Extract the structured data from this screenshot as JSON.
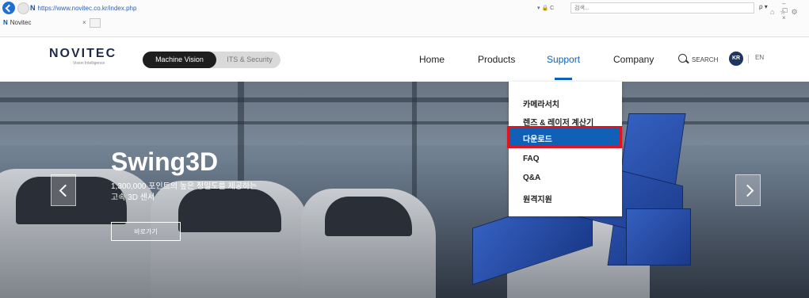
{
  "browser": {
    "url": "https://www.novitec.co.kr/index.php",
    "search_placeholder": "검색...",
    "tab_title": "Novitec",
    "tab_close": "×",
    "favicon": "N",
    "addr_tools": "▾ 🔒 C",
    "search_go": "ρ ▾",
    "right_icons": "⌂ ☆ ⚙",
    "window_controls": "–  ☐  ×"
  },
  "header": {
    "logo": "NOVITEC",
    "logo_tagline": "Vision Intelligence",
    "segment_active": "Machine Vision",
    "segment_inactive": "ITS & Security",
    "nav": [
      "Home",
      "Products",
      "Support",
      "Company"
    ],
    "active_nav": "Support",
    "search_label": "SEARCH",
    "lang_active": "KR",
    "lang_other": "EN"
  },
  "dropdown": {
    "items": [
      "카메라서치",
      "렌즈 & 레이저 계산기",
      "다운로드",
      "FAQ",
      "Q&A",
      "원격지원"
    ],
    "highlighted": "다운로드"
  },
  "hero": {
    "title": "Swing3D",
    "subtitle_line1": "1,300,000 포인트의 높은 정밀도를 제공하는",
    "subtitle_line2": "고속 3D 센서",
    "button": "바로가기"
  },
  "colors": {
    "accent": "#1060b8",
    "highlight_border": "#e0141e",
    "segment_active_bg": "#1e1e1e"
  }
}
